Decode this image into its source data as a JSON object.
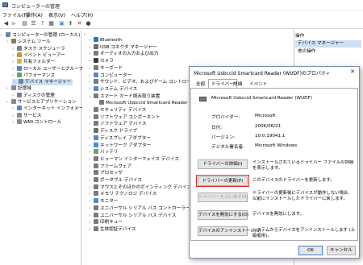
{
  "window": {
    "title": "コンピューターの管理"
  },
  "menu": [
    "ファイル(F)",
    "操作(A)",
    "表示(V)",
    "ヘルプ(H)"
  ],
  "toolbar_icons": [
    "back-icon",
    "forward-icon",
    "up-folder-icon",
    "list-icon",
    "help-icon",
    "properties-icon",
    "computer-icon",
    "update-driver-icon",
    "disable-icon",
    "uninstall-icon"
  ],
  "left_tree": [
    {
      "label": "コンピューターの管理 (ローカル)",
      "level": 0,
      "icon": "#6b84a8"
    },
    {
      "label": "システム ツール",
      "level": 1,
      "icon": "#8a7a5a"
    },
    {
      "label": "タスク スケジューラ",
      "level": 2,
      "icon": "#6b84a8"
    },
    {
      "label": "イベント ビューアー",
      "level": 2,
      "icon": "#c9962a"
    },
    {
      "label": "共有フォルダー",
      "level": 2,
      "icon": "#e0b04a"
    },
    {
      "label": "ローカル ユーザーとグループ",
      "level": 2,
      "icon": "#5b84c8"
    },
    {
      "label": "パフォーマンス",
      "level": 2,
      "icon": "#6ba06b"
    },
    {
      "label": "デバイス マネージャー",
      "level": 2,
      "icon": "#6b84a8",
      "selected": true
    },
    {
      "label": "記憶域",
      "level": 1,
      "icon": "#8a8a8a"
    },
    {
      "label": "ディスクの管理",
      "level": 2,
      "icon": "#6b84a8"
    },
    {
      "label": "サービスとアプリケーション",
      "level": 1,
      "icon": "#8a8a8a"
    },
    {
      "label": "インターネット インフォメーション",
      "level": 2,
      "icon": "#4a8ad0"
    },
    {
      "label": "サービス",
      "level": 2,
      "icon": "#8a8a8a"
    },
    {
      "label": "WMI コントロール",
      "level": 2,
      "icon": "#8a8a8a"
    }
  ],
  "device_tree": [
    {
      "label": "Bluetooth",
      "level": 1,
      "icon": "#2f6fd0"
    },
    {
      "label": "USB コネクタ マネージャー",
      "level": 1,
      "icon": "#6b6b6b"
    },
    {
      "label": "オーディオの入力および出力",
      "level": 1,
      "icon": "#7a7a7a"
    },
    {
      "label": "カメラ",
      "level": 1,
      "icon": "#3a3a3a"
    },
    {
      "label": "キーボード",
      "level": 1,
      "icon": "#7a7a7a"
    },
    {
      "label": "コンピューター",
      "level": 1,
      "icon": "#5b84c8"
    },
    {
      "label": "サウンド、ビデオ、およびゲーム コントローラー",
      "level": 1,
      "icon": "#7a7a7a"
    },
    {
      "label": "システム デバイス",
      "level": 1,
      "icon": "#5b84c8"
    },
    {
      "label": "スマート カード読み取り装置",
      "level": 1,
      "icon": "#7a7a7a",
      "expanded": true
    },
    {
      "label": "Microsoft Usbccid Smartcard Reader (WUDF)",
      "level": 2,
      "icon": "#7a7a7a"
    },
    {
      "label": "セキュリティ デバイス",
      "level": 1,
      "icon": "#7a7a7a"
    },
    {
      "label": "ソフトウェア コンポーネント",
      "level": 1,
      "icon": "#7a7a7a"
    },
    {
      "label": "ソフトウェア デバイス",
      "level": 1,
      "icon": "#7a7a7a"
    },
    {
      "label": "ディスク ドライブ",
      "level": 1,
      "icon": "#6b6b6b"
    },
    {
      "label": "ディスプレイ アダプター",
      "level": 1,
      "icon": "#4a8ad0"
    },
    {
      "label": "ネットワーク アダプター",
      "level": 1,
      "icon": "#4a8ad0"
    },
    {
      "label": "バッテリ",
      "level": 1,
      "icon": "#6ba06b"
    },
    {
      "label": "ヒューマン インターフェイス デバイス",
      "level": 1,
      "icon": "#7a7a7a"
    },
    {
      "label": "ファームウェア",
      "level": 1,
      "icon": "#7a7a7a"
    },
    {
      "label": "プロセッサ",
      "level": 1,
      "icon": "#7a7a7a"
    },
    {
      "label": "ポータブル デバイス",
      "level": 1,
      "icon": "#7a7a7a"
    },
    {
      "label": "マウスとそのほかのポインティング デバイス",
      "level": 1,
      "icon": "#7a7a7a"
    },
    {
      "label": "メモリ テクノロジ デバイス",
      "level": 1,
      "icon": "#7a7a7a"
    },
    {
      "label": "モニター",
      "level": 1,
      "icon": "#4a8ad0"
    },
    {
      "label": "ユニバーサル シリアル バス コントローラー",
      "level": 1,
      "icon": "#7a7a7a"
    },
    {
      "label": "ユニバーサル シリアル バス デバイス",
      "level": 1,
      "icon": "#7a7a7a"
    },
    {
      "label": "印刷キュー",
      "level": 1,
      "icon": "#7a7a7a"
    },
    {
      "label": "生体認証デバイス",
      "level": 1,
      "icon": "#7a7a7a"
    }
  ],
  "actions": {
    "header": "操作",
    "selected": "デバイス マネージャー",
    "more": "他の操作"
  },
  "dialog": {
    "title": "Microsoft Usbccid Smartcard Reader (WUDF)のプロパティ",
    "tabs": [
      "全般",
      "ドライバー",
      "詳細",
      "イベント"
    ],
    "active_tab": "ドライバー",
    "device_name": "Microsoft Usbccid Smartcard Reader (WUDF)",
    "fields": {
      "provider_label": "プロバイダー:",
      "provider_value": "Microsoft",
      "date_label": "日付:",
      "date_value": "2006/06/21",
      "version_label": "バージョン:",
      "version_value": "10.0.19041.1",
      "signer_label": "デジタル署名者:",
      "signer_value": "Microsoft Windows"
    },
    "buttons": {
      "details": "ドライバーの詳細(I)",
      "update": "ドライバーの更新(P)",
      "rollback": "ドライバーを元に戻す(R)",
      "disable": "デバイスを無効にする(D)",
      "uninstall": "デバイスのアンインストール(U)"
    },
    "descriptions": {
      "details": "インストールされているドライバー ファイルの詳細を表示します。",
      "update": "このデバイスのドライバーを更新します。",
      "rollback": "ドライバーの更新後にデバイスが動作しない場合、以前にインストールしたドライバーに戻します。",
      "disable": "デバイスを無効にします。",
      "uninstall": "システムからデバイスをアンインストールします (上級者用)。"
    },
    "ok": "OK",
    "cancel": "キャンセル"
  },
  "colors": {
    "highlight": "#e0252b",
    "selection": "#cde0f5"
  }
}
